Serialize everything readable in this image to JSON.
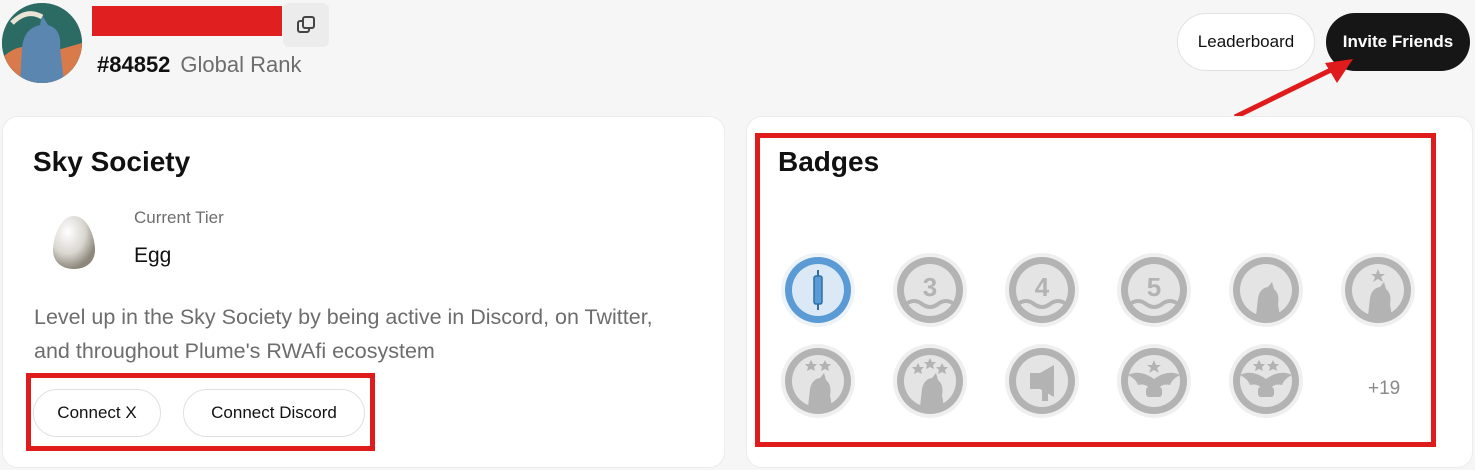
{
  "profile": {
    "rank_number": "#84852",
    "rank_label": "Global Rank"
  },
  "header": {
    "leaderboard_label": "Leaderboard",
    "invite_label": "Invite Friends"
  },
  "sky_society": {
    "title": "Sky Society",
    "tier_label": "Current Tier",
    "tier_value": "Egg",
    "description": "Level up in the Sky Society by being active in Discord, on Twitter, and throughout Plume's RWAfi ecosystem",
    "connect_x_label": "Connect X",
    "connect_discord_label": "Connect Discord"
  },
  "badges": {
    "title": "Badges",
    "more_label": "+19",
    "items": [
      {
        "name": "badge-1",
        "digit": "",
        "earned": true
      },
      {
        "name": "badge-3",
        "digit": "3",
        "earned": false
      },
      {
        "name": "badge-4",
        "digit": "4",
        "earned": false
      },
      {
        "name": "badge-5",
        "digit": "5",
        "earned": false
      },
      {
        "name": "badge-bird",
        "digit": "",
        "earned": false
      },
      {
        "name": "badge-bird-1-star",
        "digit": "",
        "earned": false
      },
      {
        "name": "badge-bird-2-stars",
        "digit": "",
        "earned": false
      },
      {
        "name": "badge-bird-3-stars",
        "digit": "",
        "earned": false
      },
      {
        "name": "badge-megaphone",
        "digit": "",
        "earned": false
      },
      {
        "name": "badge-wings-1-star",
        "digit": "",
        "earned": false
      },
      {
        "name": "badge-wings-2-stars",
        "digit": "",
        "earned": false
      }
    ]
  },
  "colors": {
    "accent_dark": "#161616",
    "annotation_red": "#e01b1b",
    "badge_grey": "#b3b3b3",
    "badge_earned_blue": "#5b9bd5"
  }
}
